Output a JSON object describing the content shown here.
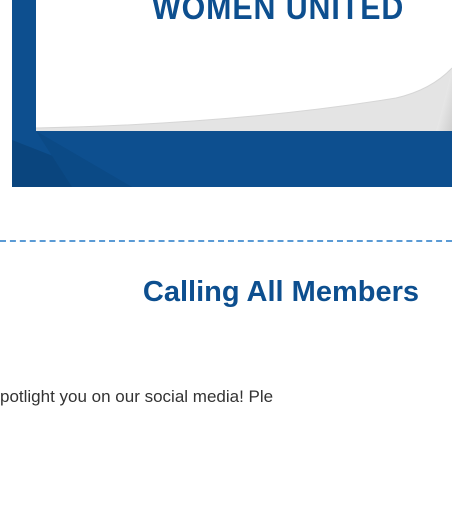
{
  "banner": {
    "headline": "WOMEN UNITED",
    "brand_color": "#0d4f8f"
  },
  "section": {
    "title": "Calling All Members",
    "body": "potlight you on our social media! Ple"
  },
  "divider_color": "#5b9bd5"
}
